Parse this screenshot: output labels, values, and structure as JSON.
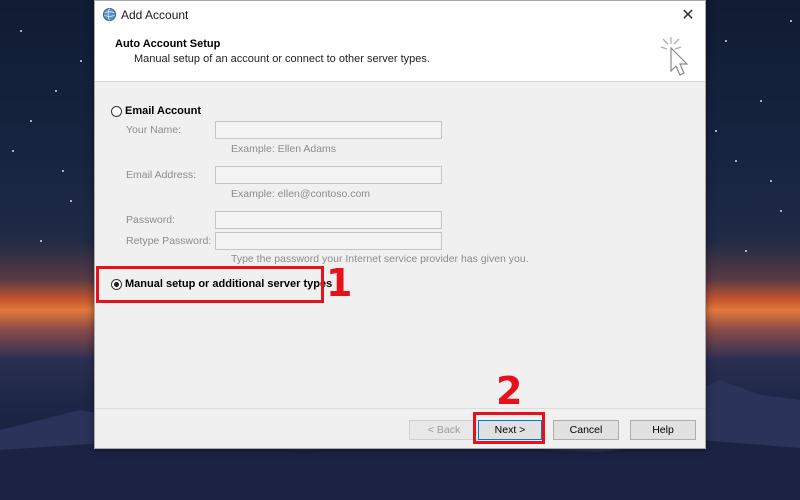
{
  "window": {
    "title": "Add Account",
    "close_glyph": "✕"
  },
  "header": {
    "title": "Auto Account Setup",
    "subtitle": "Manual setup of an account or connect to other server types."
  },
  "email_option": {
    "label": "Email Account",
    "checked": false,
    "fields": {
      "name_label": "Your Name:",
      "name_hint": "Example: Ellen Adams",
      "email_label": "Email Address:",
      "email_hint": "Example: ellen@contoso.com",
      "password_label": "Password:",
      "retype_label": "Retype Password:",
      "password_hint": "Type the password your Internet service provider has given you."
    }
  },
  "manual_option": {
    "label": "Manual setup or additional server types",
    "checked": true
  },
  "buttons": {
    "back": "< Back",
    "next": "Next >",
    "cancel": "Cancel",
    "help": "Help"
  },
  "annotations": {
    "step1": "1",
    "step2": "2",
    "color": "#e8101a"
  },
  "icons": {
    "app": "outlook-globe-icon",
    "header": "cursor-click-icon",
    "close": "close-icon"
  }
}
